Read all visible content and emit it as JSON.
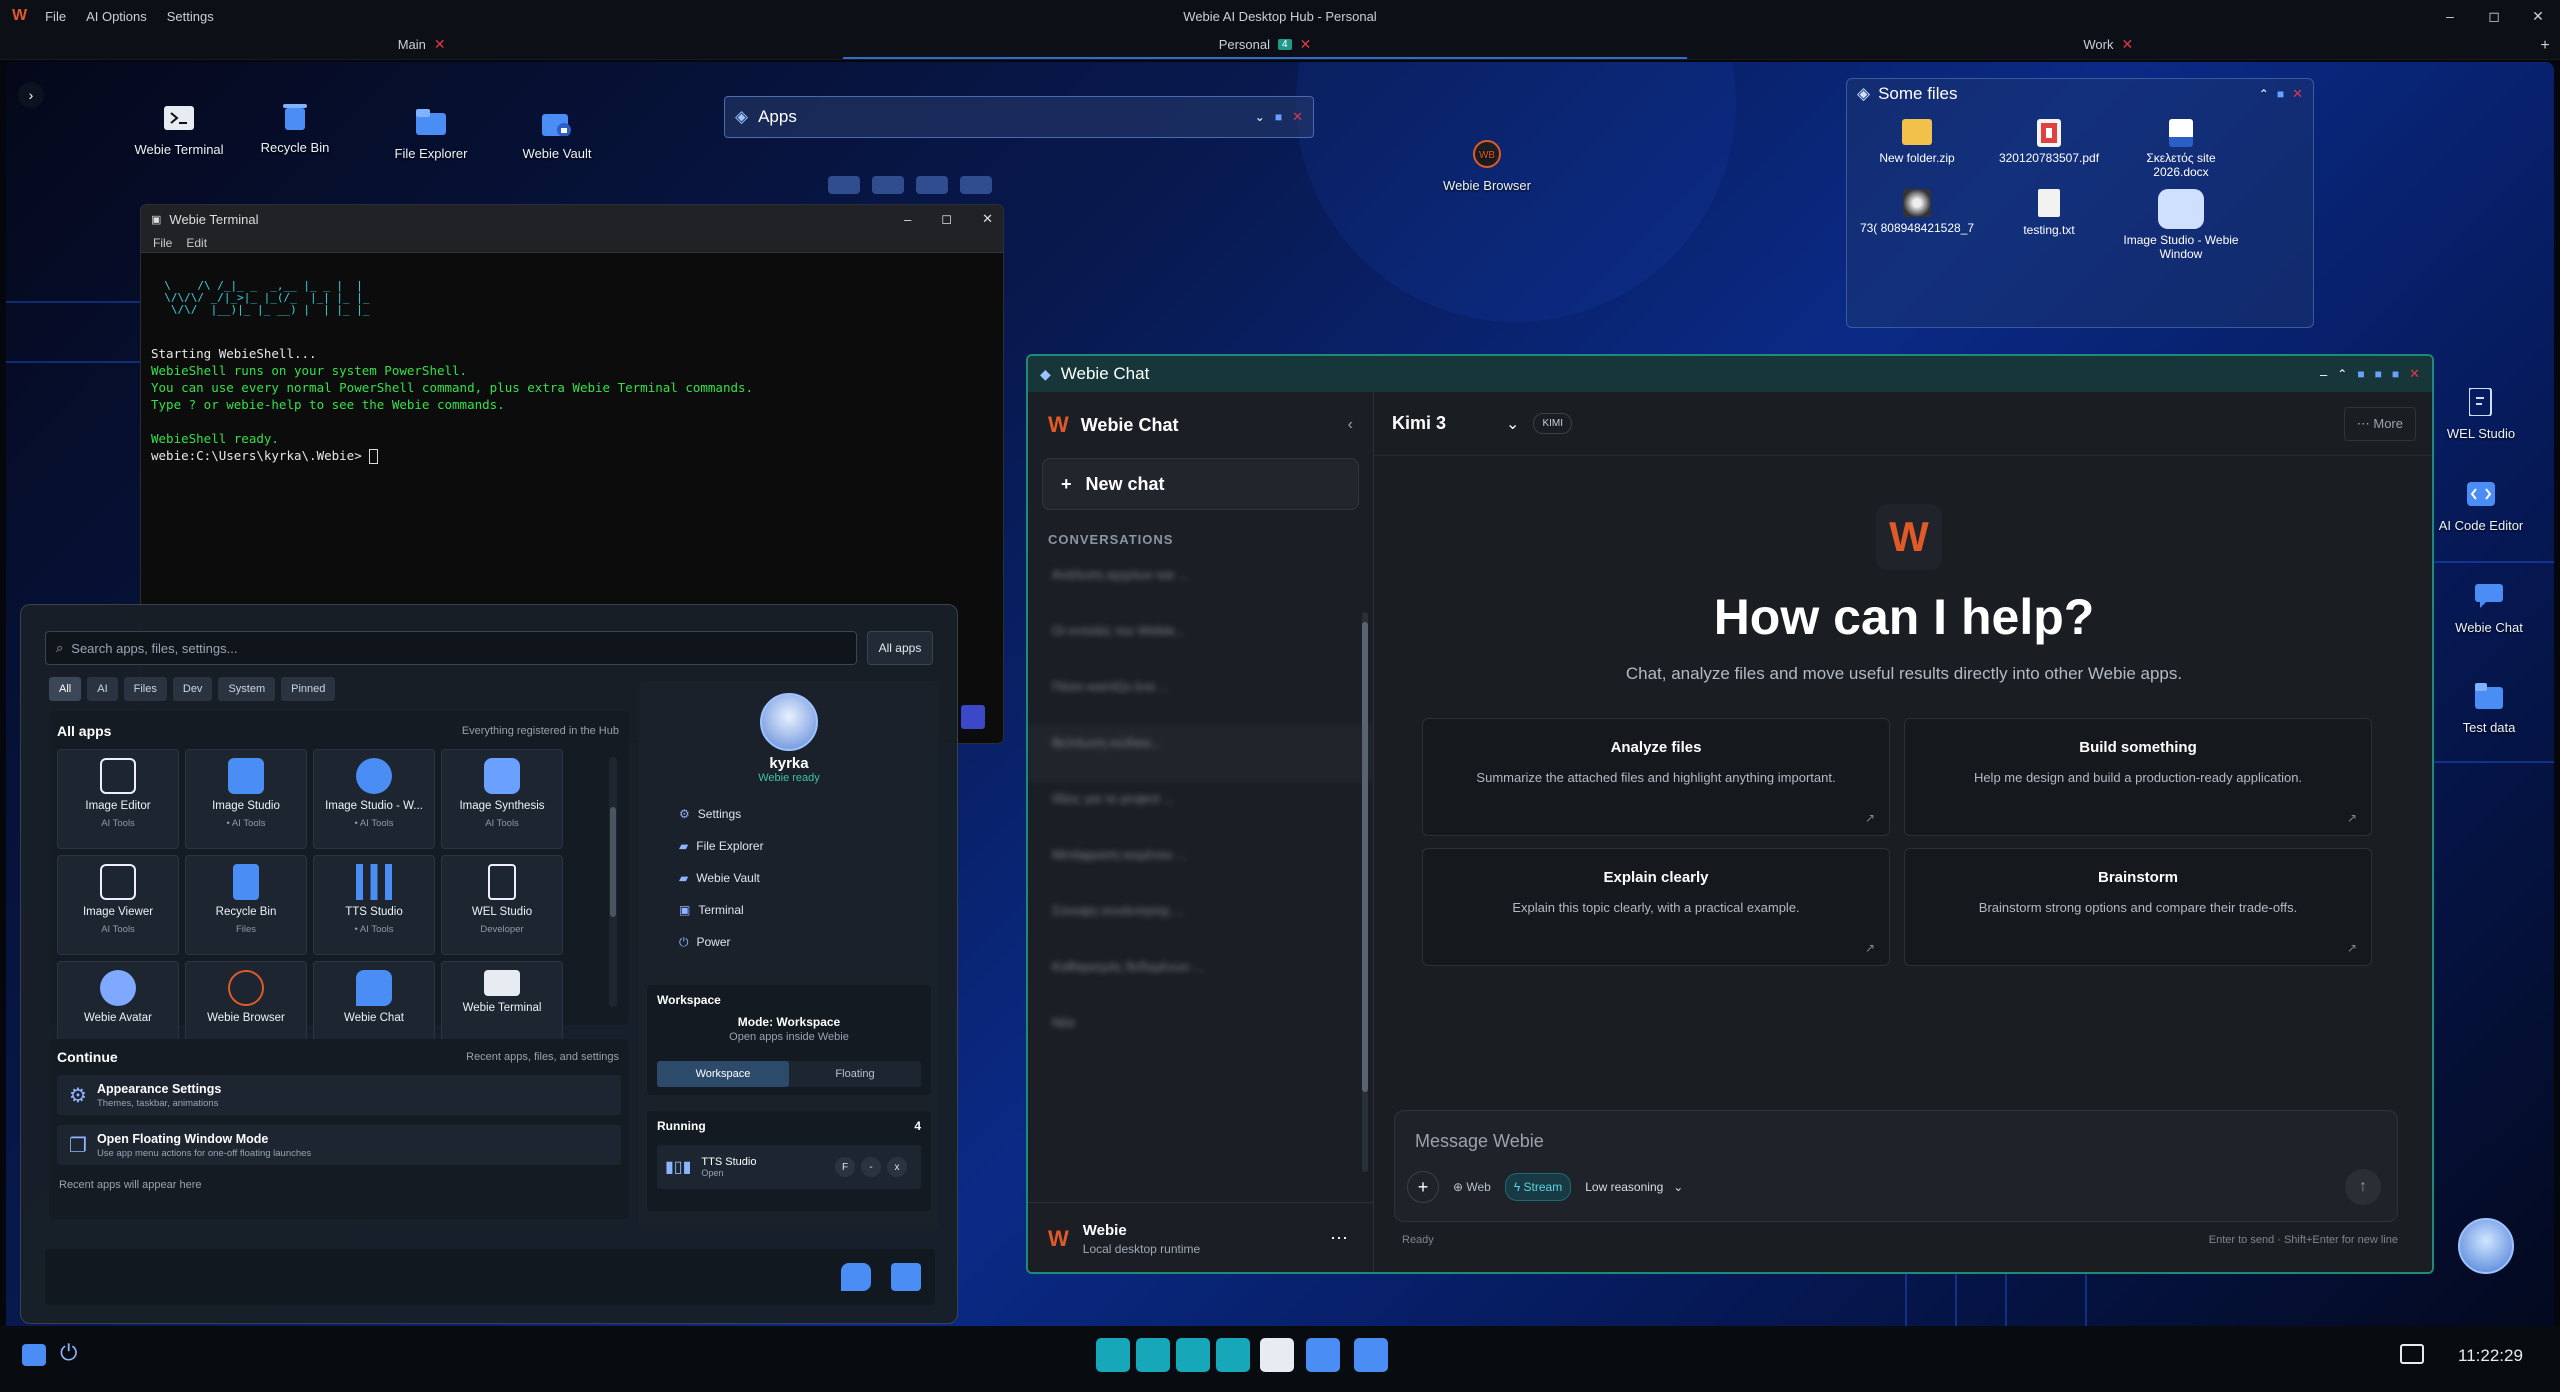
{
  "menubar": {
    "items": [
      "File",
      "AI Options",
      "Settings"
    ],
    "title": "Webie AI Desktop Hub - Personal",
    "min": "–",
    "max": "◻",
    "close": "✕"
  },
  "tabs": [
    {
      "label": "Main",
      "close": "✕"
    },
    {
      "label": "Personal",
      "badge": "4",
      "close": "✕"
    },
    {
      "label": "Work",
      "close": "✕"
    }
  ],
  "tab_add": "+",
  "desktop_icons": [
    "Webie Terminal",
    "Recycle Bin",
    "File Explorer",
    "Webie Vault",
    "Webie Browser"
  ],
  "right_icons": [
    "WEL Studio",
    "AI Code Editor",
    "Webie Chat",
    "Test data"
  ],
  "apps_bar": {
    "title": "Apps"
  },
  "some_files": {
    "title": "Some files",
    "items": [
      "New folder.zip",
      "320120783507.pdf",
      "Σκελετός site 2026.docx",
      "73( 808948421528_7",
      "testing.txt",
      "Image Studio - Webie Window"
    ]
  },
  "terminal": {
    "title": "Webie Terminal",
    "menu": [
      "File",
      "Edit"
    ],
    "art": "  \\    /\\ /_|_ _  _,__ |_ _ |  |\n  \\/\\/\\/ _/|_>|_ |_(/_  |_| |_ |_\n   \\/\\/  |__)|_ |_ __) |  | |_ |_",
    "line1": "Starting WebieShell...",
    "line2": "WebieShell runs on your system PowerShell.",
    "line3": "You can use every normal PowerShell command, plus extra Webie Terminal commands.",
    "line4": "Type ? or webie-help to see the Webie commands.",
    "line5": "WebieShell ready.",
    "prompt": "webie:C:\\Users\\kyrka\\.Webie> "
  },
  "launcher": {
    "search_placeholder": "Search apps, files, settings...",
    "all_apps_btn": "All apps",
    "filters": [
      "All",
      "AI",
      "Files",
      "Dev",
      "System",
      "Pinned"
    ],
    "all_apps_title": "All apps",
    "all_apps_hint": "Everything registered in the Hub",
    "apps": [
      {
        "name": "Image Editor",
        "cat": "AI Tools"
      },
      {
        "name": "Image Studio",
        "cat": "• AI Tools"
      },
      {
        "name": "Image Studio - W...",
        "cat": "• AI Tools"
      },
      {
        "name": "Image Synthesis",
        "cat": "AI Tools"
      },
      {
        "name": "Image Viewer",
        "cat": "AI Tools"
      },
      {
        "name": "Recycle Bin",
        "cat": "Files"
      },
      {
        "name": "TTS Studio",
        "cat": "• AI Tools"
      },
      {
        "name": "WEL Studio",
        "cat": "Developer"
      },
      {
        "name": "Webie Avatar",
        "cat": ""
      },
      {
        "name": "Webie Browser",
        "cat": ""
      },
      {
        "name": "Webie Chat",
        "cat": ""
      },
      {
        "name": "Webie Terminal",
        "cat": ""
      }
    ],
    "continue_title": "Continue",
    "continue_hint": "Recent apps, files, and settings",
    "continue_items": [
      {
        "title": "Appearance Settings",
        "sub": "Themes, taskbar, animations"
      },
      {
        "title": "Open Floating Window Mode",
        "sub": "Use app menu actions for one-off floating launches"
      }
    ],
    "recent_note": "Recent apps will appear here",
    "profile": {
      "name": "kyrka",
      "status": "Webie ready",
      "links": [
        "Settings",
        "File Explorer",
        "Webie Vault",
        "Terminal",
        "Power"
      ]
    },
    "workspace": {
      "title": "Workspace",
      "mode": "Mode: Workspace",
      "desc": "Open apps inside Webie",
      "opt1": "Workspace",
      "opt2": "Floating"
    },
    "running": {
      "title": "Running",
      "count": "4",
      "app": "TTS Studio",
      "status": "Open",
      "b1": "F",
      "b2": "-",
      "b3": "x"
    }
  },
  "chat": {
    "window_title": "Webie Chat",
    "app_name": "Webie Chat",
    "new_chat": "New chat",
    "conversations_label": "CONVERSATIONS",
    "conversations": [
      "Ανάλυση αρχείων και ...",
      "Οι εντολές του Webie...",
      "Πόσο κοστίζει ένα ...",
      "Βελτίωση κώδικα...",
      "Ιδέες για το project ...",
      "Μετάφραση κειμένου ...",
      "Σύνοψη συνάντησης ...",
      "Καθαρισμός δεδομένων ...",
      "Νέα"
    ],
    "model": "Kimi 3",
    "model_badge": "KIMI",
    "more": "More",
    "headline": "How can I help?",
    "subline": "Chat, analyze files and move useful results directly into other Webie apps.",
    "suggestions": [
      {
        "title": "Analyze files",
        "desc": "Summarize the attached files and highlight anything important."
      },
      {
        "title": "Build something",
        "desc": "Help me design and build a production-ready application."
      },
      {
        "title": "Explain clearly",
        "desc": "Explain this topic clearly, with a practical example."
      },
      {
        "title": "Brainstorm",
        "desc": "Brainstorm strong options and compare their trade-offs."
      }
    ],
    "composer_placeholder": "Message Webie",
    "web": "Web",
    "stream": "Stream",
    "reasoning": "Low reasoning",
    "status": "Ready",
    "hint": "Enter to send · Shift+Enter for new line",
    "user_name": "Webie",
    "user_sub": "Local desktop runtime"
  },
  "clock": "11:22:29"
}
